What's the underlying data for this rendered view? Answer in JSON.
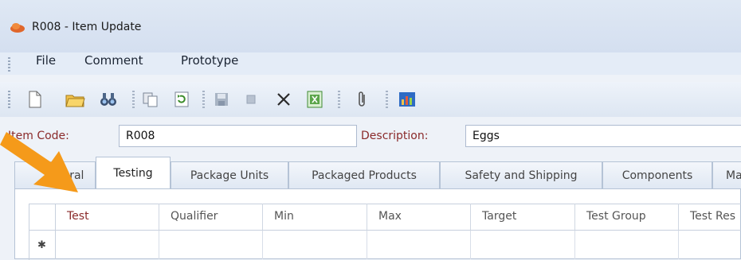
{
  "window": {
    "title": "R008 - Item Update",
    "icon": "app-cloud-icon"
  },
  "menu": {
    "items": [
      "File",
      "Comment",
      "Prototype"
    ]
  },
  "toolbar": {
    "buttons": [
      "new-icon",
      "open-folder-icon",
      "binoculars-find-icon",
      "copy-icon",
      "refresh-icon",
      "save-icon",
      "stop-icon",
      "delete-x-icon",
      "excel-export-icon",
      "attach-paperclip-icon",
      "chart-icon"
    ]
  },
  "form": {
    "item_code_label": "Item Code:",
    "item_code_value": "R008",
    "description_label": "Description:",
    "description_value": "Eggs"
  },
  "tabs": [
    {
      "label": "General",
      "visible": "eral",
      "active": false
    },
    {
      "label": "Testing",
      "active": true
    },
    {
      "label": "Package Units",
      "active": false
    },
    {
      "label": "Packaged Products",
      "active": false
    },
    {
      "label": "Safety and Shipping",
      "active": false
    },
    {
      "label": "Components",
      "active": false
    },
    {
      "label": "Ma",
      "active": false
    }
  ],
  "grid": {
    "columns": [
      "Test",
      "Qualifier",
      "Min",
      "Max",
      "Target",
      "Test Group",
      "Test Res"
    ],
    "new_row_marker": "✱"
  },
  "colors": {
    "accent_arrow": "#f59a1a",
    "label_red": "#8a2a2a",
    "first_col_header": "#8a2a2a"
  }
}
